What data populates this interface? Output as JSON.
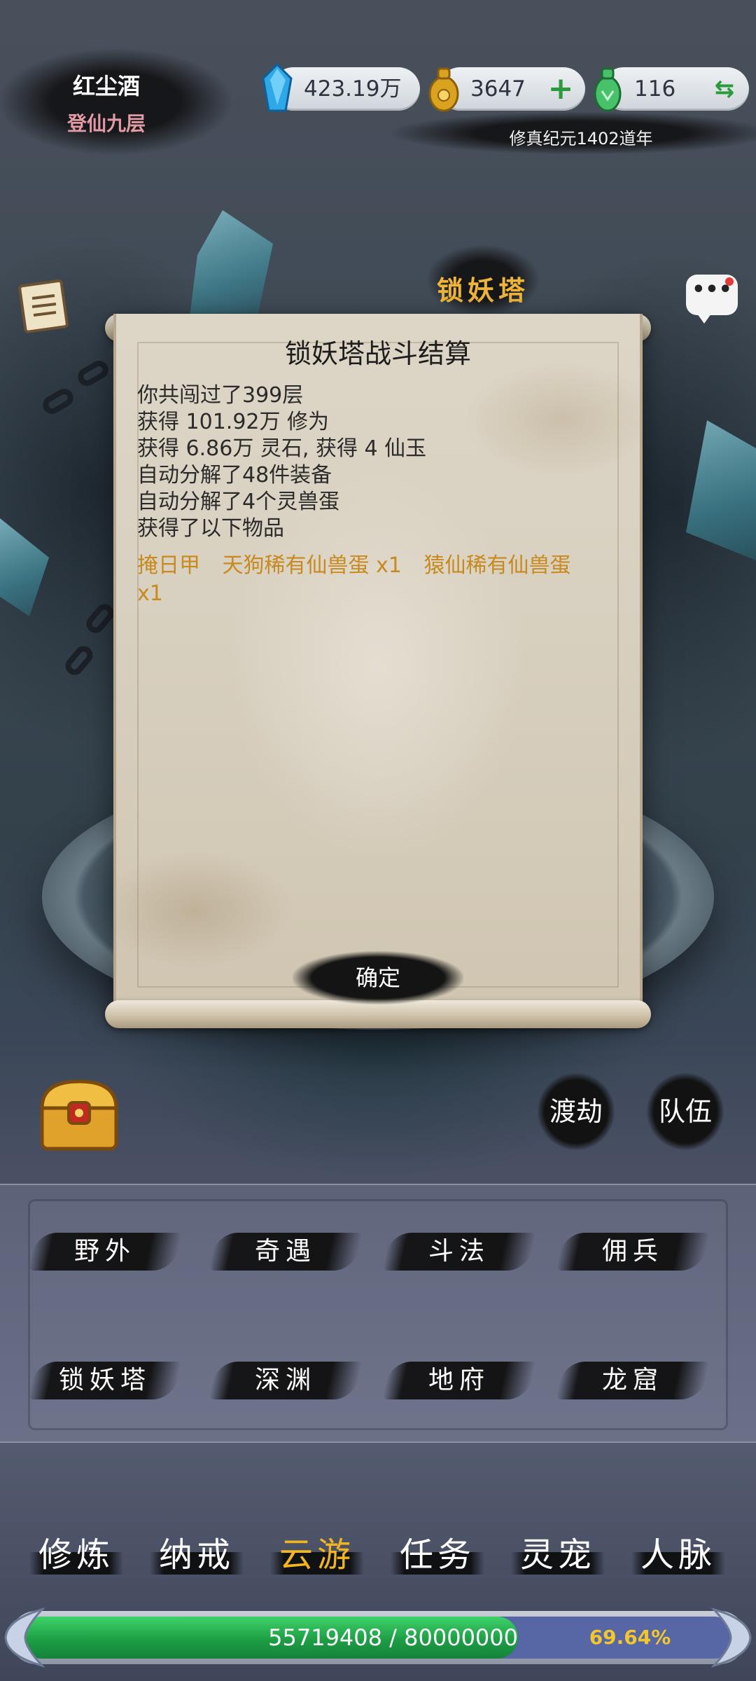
{
  "player": {
    "name": "红尘酒",
    "rank": "登仙九层"
  },
  "currencies": [
    {
      "id": "spirit-crystal",
      "value": "423.19万",
      "icon": "blue-crystal-icon",
      "action": ""
    },
    {
      "id": "gold-coin",
      "value": "3647",
      "icon": "gold-coin-pouch-icon",
      "action": "+"
    },
    {
      "id": "jade",
      "value": "116",
      "icon": "green-jade-pouch-icon",
      "action": "⇆"
    }
  ],
  "era": "修真纪元1402道年",
  "location_title": "锁妖塔",
  "chat": {
    "icon": "chat-bubble-icon",
    "glyph": "•••",
    "has_notification": true
  },
  "dialog": {
    "title": "锁妖塔战斗结算",
    "lines": [
      "你共闯过了399层",
      "获得 101.92万 修为",
      "获得 6.86万 灵石, 获得 4 仙玉",
      "自动分解了48件装备",
      "自动分解了4个灵兽蛋",
      "获得了以下物品"
    ],
    "items": [
      "掩日甲",
      "天狗稀有仙兽蛋 x1",
      "猿仙稀有仙兽蛋 x1"
    ],
    "confirm_label": "确定"
  },
  "side_buttons": {
    "tribulation": "渡劫",
    "team": "队伍"
  },
  "activities": [
    {
      "id": "wild",
      "label": "野外"
    },
    {
      "id": "encounter",
      "label": "奇遇"
    },
    {
      "id": "duel",
      "label": "斗法"
    },
    {
      "id": "mercenary",
      "label": "佣兵"
    },
    {
      "id": "demon-tower",
      "label": "锁妖塔"
    },
    {
      "id": "abyss",
      "label": "深渊"
    },
    {
      "id": "underworld",
      "label": "地府"
    },
    {
      "id": "dragon-lair",
      "label": "龙窟"
    }
  ],
  "nav": [
    {
      "id": "cultivate",
      "label": "修炼",
      "active": false
    },
    {
      "id": "storage-ring",
      "label": "纳戒",
      "active": false
    },
    {
      "id": "travel",
      "label": "云游",
      "active": true
    },
    {
      "id": "quests",
      "label": "任务",
      "active": false
    },
    {
      "id": "pets",
      "label": "灵宠",
      "active": false
    },
    {
      "id": "contacts",
      "label": "人脉",
      "active": false
    }
  ],
  "cultivation": {
    "current": 55719408,
    "max": 80000000,
    "text": "55719408 / 80000000",
    "percent_label": "69.64%",
    "fraction": 0.6964
  },
  "colors": {
    "accent_gold": "#f2b520",
    "reward_text": "#c8891e",
    "progress_green": "#1e9e45",
    "progress_track": "#5766a4",
    "rank_pink": "#e29aa5"
  }
}
